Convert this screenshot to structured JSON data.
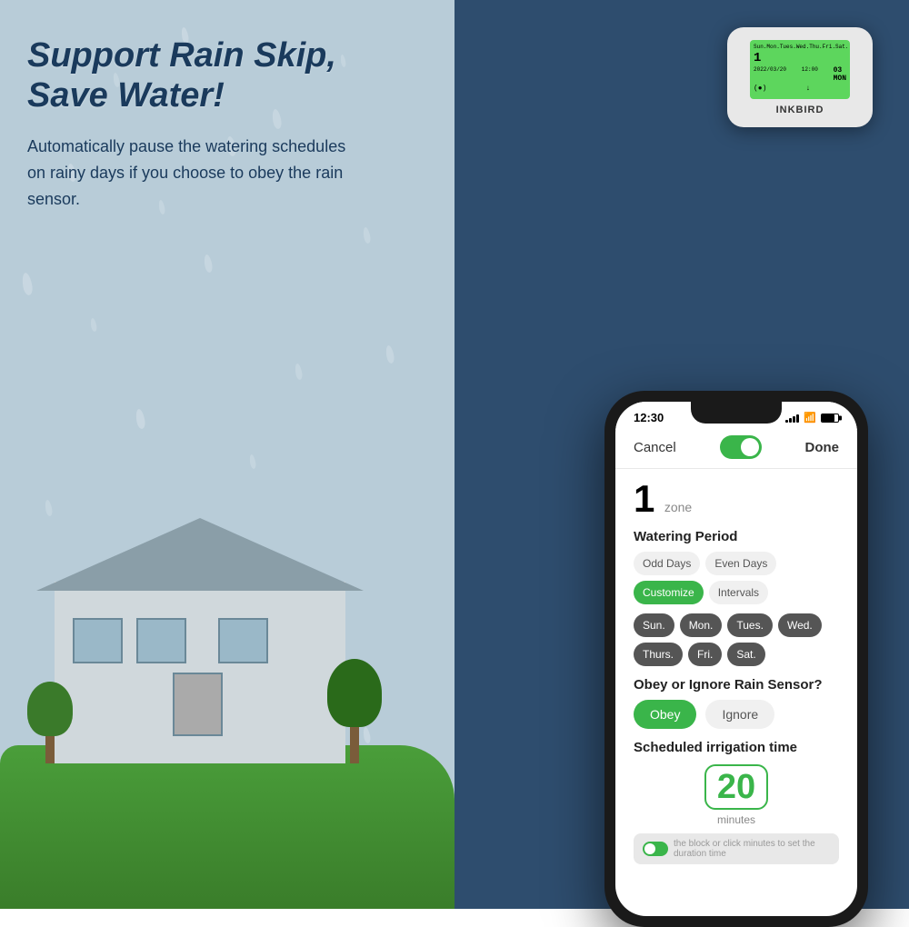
{
  "left": {
    "headline_line1": "Support Rain Skip,",
    "headline_line2": "Save Water!",
    "subtext": "Automatically pause the watering schedules on rainy days if you choose to obey the rain sensor."
  },
  "device": {
    "brand": "INKBIRD",
    "screen_lines": [
      "Sun. Mon. Tues. Wed. Thu. Fri. Sat.",
      "1",
      "2022/03/20  12:00",
      "(●)          ↓"
    ]
  },
  "phone": {
    "status_time": "12:30",
    "nav": {
      "cancel": "Cancel",
      "done": "Done"
    },
    "zone_number": "1",
    "zone_label": "zone",
    "watering_period": {
      "title": "Watering Period",
      "buttons": [
        {
          "label": "Odd Days",
          "active": false
        },
        {
          "label": "Even Days",
          "active": false
        },
        {
          "label": "Customize",
          "active": true
        },
        {
          "label": "Intervals",
          "active": false
        }
      ]
    },
    "days": [
      {
        "label": "Sun.",
        "active": true
      },
      {
        "label": "Mon.",
        "active": true
      },
      {
        "label": "Tues.",
        "active": true
      },
      {
        "label": "Wed.",
        "active": true
      },
      {
        "label": "Thurs.",
        "active": true
      },
      {
        "label": "Fri.",
        "active": true
      },
      {
        "label": "Sat.",
        "active": true
      }
    ],
    "rain_sensor": {
      "title": "Obey or Ignore Rain Sensor?",
      "buttons": [
        {
          "label": "Obey",
          "active": true
        },
        {
          "label": "Ignore",
          "active": false
        }
      ]
    },
    "irrigation": {
      "title": "Scheduled irrigation time",
      "value": "20",
      "unit": "minutes"
    },
    "hint": "the block or click minutes to set the duration time"
  }
}
